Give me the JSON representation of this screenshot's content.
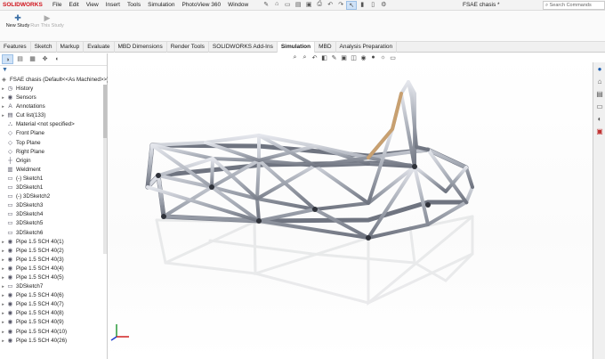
{
  "app": {
    "logo": "SOLIDWORKS",
    "document_title": "FSAE chasis *",
    "search_placeholder": "Search Commands"
  },
  "menu": [
    "File",
    "Edit",
    "View",
    "Insert",
    "Tools",
    "Simulation",
    "PhotoView 360",
    "Window"
  ],
  "commands": {
    "new_study": "New Study",
    "run_study": "Run This Study"
  },
  "tabs": [
    "Features",
    "Sketch",
    "Markup",
    "Evaluate",
    "MBD Dimensions",
    "Render Tools",
    "SOLIDWORKS Add-Ins",
    "Simulation",
    "MBD",
    "Analysis Preparation"
  ],
  "active_tab": "Simulation",
  "tree": {
    "root": "FSAE chasis (Default<<As Machined>>)",
    "items": [
      "History",
      "Sensors",
      "Annotations",
      "Cut list(133)",
      "Material <not specified>",
      "Front Plane",
      "Top Plane",
      "Right Plane",
      "Origin",
      "Weldment",
      "(-) Sketch1",
      "3DSketch1",
      "(-) 3DSketch2",
      "3DSketch3",
      "3DSketch4",
      "3DSketch5",
      "3DSketch6",
      "Pipe 1.5 SCH 40(1)",
      "Pipe 1.5 SCH 40(2)",
      "Pipe 1.5 SCH 40(3)",
      "Pipe 1.5 SCH 40(4)",
      "Pipe 1.5 SCH 40(5)",
      "3DSketch7",
      "Pipe 1.5 SCH 40(6)",
      "Pipe 1.5 SCH 40(7)",
      "Pipe 1.5 SCH 40(8)",
      "Pipe 1.5 SCH 40(9)",
      "Pipe 1.5 SCH 40(10)",
      "Pipe 1.5 SCH 40(26)"
    ]
  },
  "colors": {
    "tube": "#b8bcc6",
    "tube_highlight": "#c8a070",
    "accent": "#3a6ea5",
    "logo_red": "#d0121b"
  }
}
